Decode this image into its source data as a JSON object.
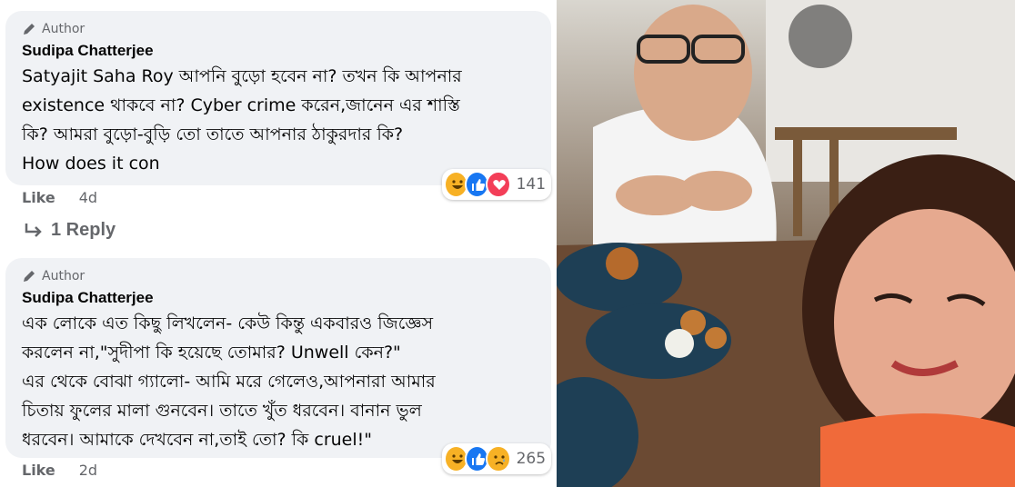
{
  "comments": [
    {
      "badge": "Author",
      "name": "Sudipa Chatterjee",
      "text": "Satyajit Saha Roy আপনি বুড়ো হবেন না? তখন কি আপনার\nexistence থাকবে না? Cyber crime করেন,জানেন এর শাস্তি\nকি? আমরা বুড়ো-বুড়ি তো তাতে আপনার ঠাকুরদার কি?\nHow does it con",
      "reaction_count": "141",
      "reactions": [
        "haha-icon",
        "like-icon",
        "love-icon"
      ],
      "like_label": "Like",
      "time": "4d"
    },
    {
      "badge": "Author",
      "name": "Sudipa Chatterjee",
      "text": "এক লোকে এত কিছু লিখলেন- কেউ কিন্তু একবারও জিজ্ঞেস\nকরলেন না,\"সুদীপা কি হয়েছে তোমার? Unwell কেন?\"\nএর থেকে বোঝা গ্যালো- আমি মরে গেলেও,আপনারা আমার\nচিতায় ফুলের মালা গুনবেন। তাতে খুঁত ধরবেন। বানান ভুল\nধরবেন। আমাকে দেখবেন না,তাই তো? কি cruel!\"",
      "reaction_count": "265",
      "reactions": [
        "haha-icon",
        "like-icon",
        "sad-icon"
      ],
      "like_label": "Like",
      "time": "2d"
    }
  ],
  "reply_link": "1 Reply",
  "colors": {
    "bubble": "#f0f2f5",
    "meta": "#65676b",
    "text": "#050505",
    "like_blue": "#1877f2"
  }
}
